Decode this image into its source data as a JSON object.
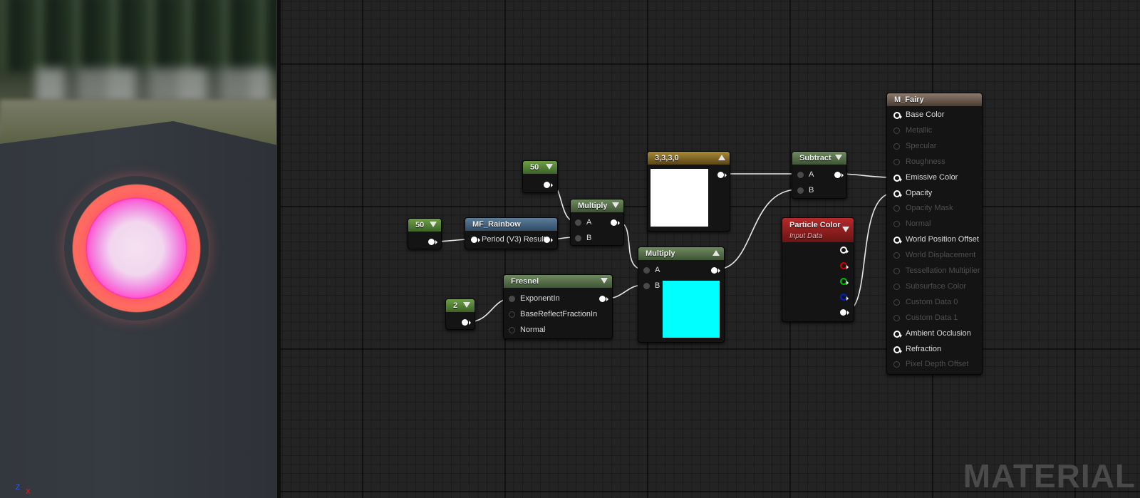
{
  "viewport": {
    "axis_z": "Z",
    "axis_x": "X"
  },
  "nodes": {
    "const_50_top": {
      "value": "50"
    },
    "const_50_left": {
      "value": "50"
    },
    "const_2": {
      "value": "2"
    },
    "rainbow": {
      "title": "MF_Rainbow",
      "pin": "Period (V3) Result"
    },
    "multiply1": {
      "title": "Multiply",
      "pin_a": "A",
      "pin_b": "B"
    },
    "vector": {
      "title": "3,3,3,0",
      "swatch_color": "#ffffff"
    },
    "fresnel": {
      "title": "Fresnel",
      "pins": [
        "ExponentIn",
        "BaseReflectFractionIn",
        "Normal"
      ]
    },
    "multiply2": {
      "title": "Multiply",
      "pin_a": "A",
      "pin_b": "B",
      "swatch_color": "#00ffff"
    },
    "subtract": {
      "title": "Subtract",
      "pin_a": "A",
      "pin_b": "B"
    },
    "particle": {
      "title": "Particle Color",
      "subtitle": "Input Data"
    },
    "material": {
      "title": "M_Fairy",
      "pins": [
        {
          "label": "Base Color",
          "active": true
        },
        {
          "label": "Metallic",
          "active": false
        },
        {
          "label": "Specular",
          "active": false
        },
        {
          "label": "Roughness",
          "active": false
        },
        {
          "label": "Emissive Color",
          "active": true
        },
        {
          "label": "Opacity",
          "active": true
        },
        {
          "label": "Opacity Mask",
          "active": false
        },
        {
          "label": "Normal",
          "active": false
        },
        {
          "label": "World Position Offset",
          "active": true
        },
        {
          "label": "World Displacement",
          "active": false
        },
        {
          "label": "Tessellation Multiplier",
          "active": false
        },
        {
          "label": "Subsurface Color",
          "active": false
        },
        {
          "label": "Custom Data 0",
          "active": false
        },
        {
          "label": "Custom Data 1",
          "active": false
        },
        {
          "label": "Ambient Occlusion",
          "active": true
        },
        {
          "label": "Refraction",
          "active": true
        },
        {
          "label": "Pixel Depth Offset",
          "active": false
        }
      ]
    }
  },
  "watermark": "MATERIAL"
}
